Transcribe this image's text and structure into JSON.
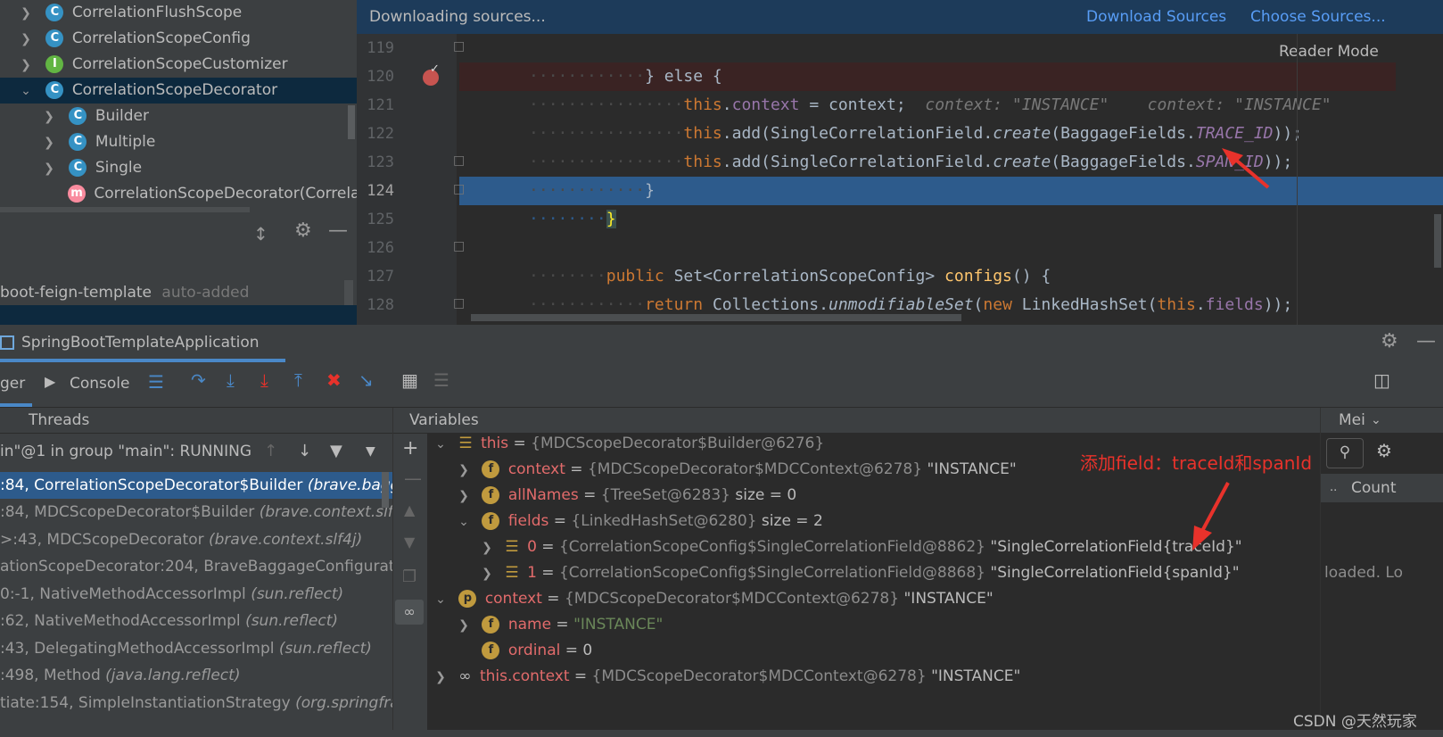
{
  "project_tree": {
    "items": [
      {
        "label": "CorrelationFlushScope",
        "icon": "C",
        "expanded": false
      },
      {
        "label": "CorrelationScopeConfig",
        "icon": "C",
        "expanded": false
      },
      {
        "label": "CorrelationScopeCustomizer",
        "icon": "I",
        "expanded": false
      },
      {
        "label": "CorrelationScopeDecorator",
        "icon": "C",
        "expanded": true
      },
      {
        "label": "Builder",
        "icon": "C",
        "expanded": false
      },
      {
        "label": "Multiple",
        "icon": "C",
        "expanded": false
      },
      {
        "label": "Single",
        "icon": "C",
        "expanded": false
      },
      {
        "label": "CorrelationScopeDecorator(Correlat",
        "icon": "m",
        "expanded": false
      }
    ]
  },
  "module_row": {
    "name": "boot-feign-template",
    "note": "auto-added"
  },
  "editor_banner": {
    "message": "Downloading sources...",
    "download": "Download Sources",
    "choose": "Choose Sources..."
  },
  "reader_mode": "Reader Mode",
  "code": {
    "line_numbers": [
      "119",
      "120",
      "121",
      "122",
      "123",
      "124",
      "125",
      "126",
      "127",
      "128"
    ],
    "l119_dots": "············",
    "l119": "} else {",
    "l120_dots": "················",
    "l120_this": "this",
    ".": ".",
    "l120_field": "context",
    "l120_eq": " = context;",
    "l120_hint": "  context: \"INSTANCE\"    context: \"INSTANCE\"",
    "l121_dots": "················",
    "l121_a": "this",
    "l121_b": ".add(SingleCorrelationField.",
    "l121_c": "create",
    "l121_d": "(BaggageFields.",
    "l121_e": "TRACE_ID",
    "l121_f": "));",
    "l122_dots": "················",
    "l122_a": "this",
    "l122_b": ".add(SingleCorrelationField.",
    "l122_c": "create",
    "l122_d": "(BaggageFields.",
    "l122_e": "SPAN_ID",
    "l122_f": "));",
    "l123_dots": "············",
    "l123": "}",
    "l124_dots": "········",
    "l124": "}",
    "l126_dots": "········",
    "l126_a": "public ",
    "l126_b": "Set<CorrelationScopeConfig> ",
    "l126_c": "configs",
    "l126_d": "() {",
    "l127_dots": "············",
    "l127_a": "return ",
    "l127_b": "Collections.",
    "l127_c": "unmodifiableSet",
    "l127_d": "(",
    "l127_e": "new ",
    "l127_f": "LinkedHashSet(",
    "l127_g": "this",
    "l127_h": "fields",
    "l127_i": "));",
    "l128_dots": "········",
    "l128": "}"
  },
  "run_tab": {
    "title": "SpringBootTemplateApplication"
  },
  "debug_tabs": {
    "debugger": "ger",
    "console": "Console"
  },
  "threads_header": "Threads",
  "variables_header": "Variables",
  "memory_header": "Mei",
  "count_label": "Count",
  "count_dots": "..",
  "thread_select": "in\"@1 in group \"main\": RUNNING",
  "frames": [
    {
      "loc": ":84, CorrelationScopeDecorator$Builder",
      "pkg": "(brave.bagg"
    },
    {
      "loc": ":84, MDCScopeDecorator$Builder",
      "pkg": "(brave.context.slf4"
    },
    {
      "loc": ">:43, MDCScopeDecorator",
      "pkg": "(brave.context.slf4j)"
    },
    {
      "loc": "ationScopeDecorator:204, BraveBaggageConfiguratic",
      "pkg": ""
    },
    {
      "loc": "0:-1, NativeMethodAccessorImpl",
      "pkg": "(sun.reflect)"
    },
    {
      "loc": ":62, NativeMethodAccessorImpl",
      "pkg": "(sun.reflect)"
    },
    {
      "loc": ":43, DelegatingMethodAccessorImpl",
      "pkg": "(sun.reflect)"
    },
    {
      "loc": ":498, Method",
      "pkg": "(java.lang.reflect)"
    },
    {
      "loc": "tiate:154, SimpleInstantiationStrategy",
      "pkg": "(org.springfra"
    }
  ],
  "variables": [
    {
      "name": "this",
      "eq": " = ",
      "val": "{MDCScopeDecorator$Builder@6276}",
      "extra": ""
    },
    {
      "name": "context",
      "eq": " = ",
      "val": "{MDCScopeDecorator$MDCContext@6278}",
      "extra": " \"INSTANCE\""
    },
    {
      "name": "allNames",
      "eq": " = ",
      "val": "{TreeSet@6283}",
      "extra": "  size = 0"
    },
    {
      "name": "fields",
      "eq": " = ",
      "val": "{LinkedHashSet@6280}",
      "extra": "  size = 2"
    },
    {
      "name": "0",
      "eq": " = ",
      "val": "{CorrelationScopeConfig$SingleCorrelationField@8862}",
      "extra": " \"SingleCorrelationField{traceId}\""
    },
    {
      "name": "1",
      "eq": " = ",
      "val": "{CorrelationScopeConfig$SingleCorrelationField@8868}",
      "extra": " \"SingleCorrelationField{spanId}\""
    },
    {
      "name": "context",
      "eq": " = ",
      "val": "{MDCScopeDecorator$MDCContext@6278}",
      "extra": " \"INSTANCE\""
    },
    {
      "name": "name",
      "eq": " = ",
      "val": "\"INSTANCE\"",
      "extra": ""
    },
    {
      "name": "ordinal",
      "eq": " = ",
      "val": "",
      "extra": "0"
    },
    {
      "name": "this.context",
      "eq": " = ",
      "val": "{MDCScopeDecorator$MDCContext@6278}",
      "extra": " \"INSTANCE\""
    }
  ],
  "annotation": "添加field：traceId和spanId",
  "loaded_text": "loaded. Lo",
  "watermark": "CSDN @天然玩家",
  "colors": {
    "accent": "#2d5b8c",
    "annotation": "#e8322b",
    "breakpoint": "#c75450"
  }
}
